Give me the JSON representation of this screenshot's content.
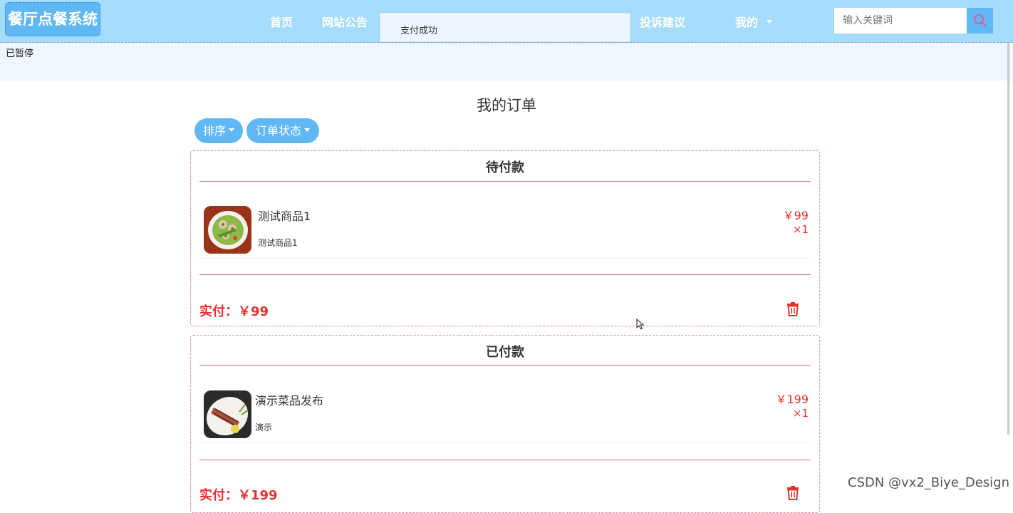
{
  "header": {
    "logo_text": "餐厅点餐系统",
    "nav": [
      "首页",
      "网站公告",
      "投诉建议",
      "我的"
    ],
    "search_placeholder": "输入关键词"
  },
  "toast": {
    "message": "支付成功"
  },
  "status_text": "已暂停",
  "page": {
    "title": "我的订单",
    "sort_label": "排序",
    "status_filter_label": "订单状态"
  },
  "orders": [
    {
      "status": "待付款",
      "item_name": "测试商品1",
      "item_desc": "测试商品1",
      "price": "￥99",
      "qty": "×1",
      "paid_label": "实付：￥99"
    },
    {
      "status": "已付款",
      "item_name": "演示菜品发布",
      "item_desc": "演示",
      "price": "￥199",
      "qty": "×1",
      "paid_label": "实付：￥199"
    }
  ],
  "watermark": "CSDN @vx2_Biye_Design",
  "colors": {
    "header_bg": "#a6dcfb",
    "accent": "#5fb8f4",
    "price_red": "#e5322d",
    "card_border": "#e08aa5"
  }
}
